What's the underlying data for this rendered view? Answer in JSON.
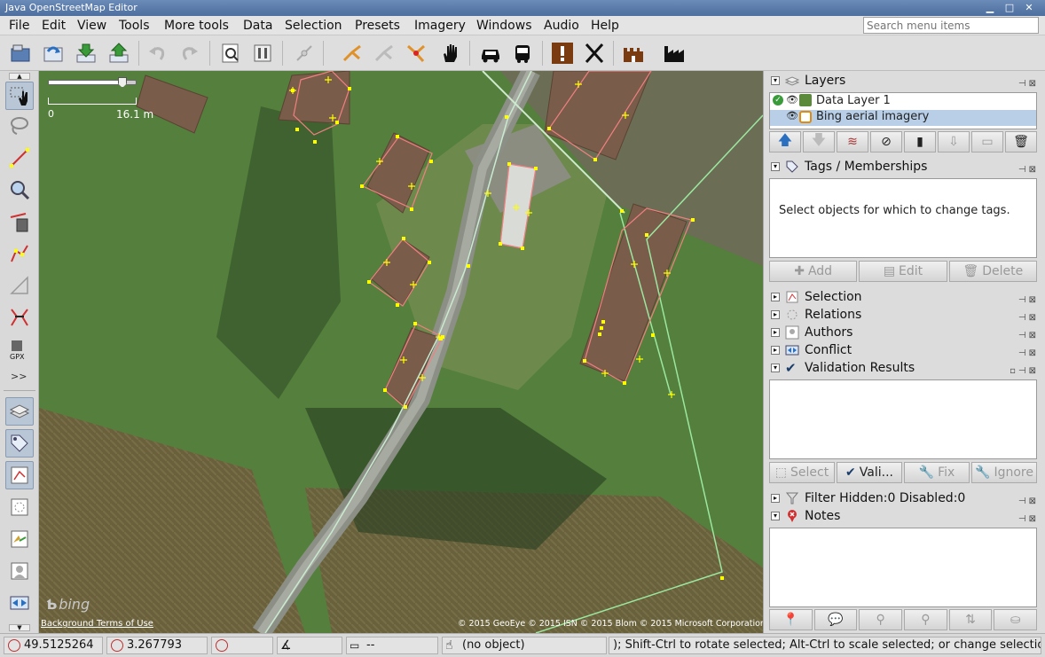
{
  "window": {
    "title": "Java OpenStreetMap Editor"
  },
  "menubar": {
    "items": [
      "File",
      "Edit",
      "View",
      "Tools",
      "More tools",
      "Data",
      "Selection",
      "Presets",
      "Imagery",
      "Windows",
      "Audio",
      "Help"
    ],
    "search_placeholder": "Search menu items"
  },
  "map": {
    "scale_zero": "0",
    "scale_label": "16.1 m",
    "bing_logo": "bing",
    "terms_link": "Background Terms of Use",
    "attribution": "© 2015 GeoEye © 2015 ISN © 2015 Blom © 2015 Microsoft Corporation"
  },
  "left_tools": {
    "more_label": ">>"
  },
  "layers_panel": {
    "title": "Layers",
    "layers": [
      {
        "name": "Data Layer 1",
        "active": true,
        "visible": true
      },
      {
        "name": "Bing aerial imagery",
        "active": false,
        "visible": true,
        "selected": true
      }
    ]
  },
  "tags_panel": {
    "title": "Tags / Memberships",
    "message": "Select objects for which to change tags.",
    "buttons": {
      "add": "Add",
      "edit": "Edit",
      "delete": "Delete"
    }
  },
  "collapsed_panels": [
    "Selection",
    "Relations",
    "Authors",
    "Conflict"
  ],
  "validation_panel": {
    "title": "Validation Results",
    "buttons": {
      "select": "Select",
      "validate": "Vali...",
      "fix": "Fix",
      "ignore": "Ignore"
    }
  },
  "filter_panel": {
    "title": "Filter Hidden:0 Disabled:0"
  },
  "notes_panel": {
    "title": "Notes"
  },
  "statusbar": {
    "lat": "49.5125264",
    "lon": "3.267793",
    "heading": "",
    "angle": "",
    "distance": "--",
    "object": "(no object)",
    "help": "); Shift-Ctrl to rotate selected; Alt-Ctrl to scale selected; or change selection"
  },
  "colors": {
    "title_bar": "#5677a8",
    "selection": "#b9cfe8",
    "osm_way": "#f08080",
    "osm_node": "#ffff00",
    "osm_line": "#9be7a0"
  }
}
